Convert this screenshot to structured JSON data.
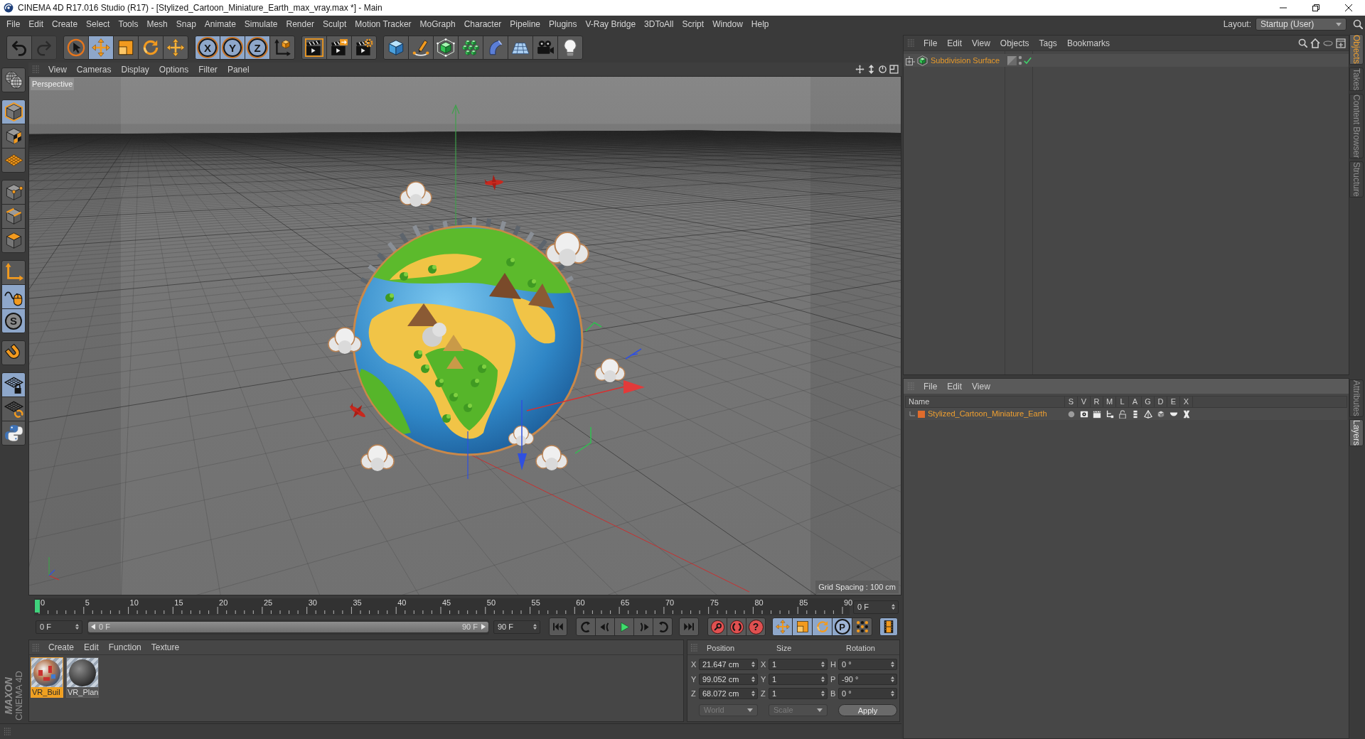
{
  "window": {
    "title": "CINEMA 4D R17.016 Studio (R17) - [Stylized_Cartoon_Miniature_Earth_max_vray.max *] - Main"
  },
  "menu_bar": {
    "items": [
      "File",
      "Edit",
      "Create",
      "Select",
      "Tools",
      "Mesh",
      "Snap",
      "Animate",
      "Simulate",
      "Render",
      "Sculpt",
      "Motion Tracker",
      "MoGraph",
      "Character",
      "Pipeline",
      "Plugins",
      "V-Ray Bridge",
      "3DToAll",
      "Script",
      "Window",
      "Help"
    ],
    "layout_label": "Layout:",
    "layout_value": "Startup (User)"
  },
  "toolbar": {
    "groups": [
      [
        {
          "active": false,
          "disabled": false
        },
        {
          "active": false,
          "disabled": true
        }
      ],
      [
        {
          "active": false,
          "disabled": false
        },
        {
          "active": true,
          "disabled": false
        },
        {
          "active": false,
          "disabled": false
        },
        {
          "active": false,
          "disabled": false
        },
        {
          "active": false,
          "disabled": false
        }
      ],
      [
        {
          "label": "X",
          "active": true,
          "disabled": false
        },
        {
          "label": "Y",
          "active": true,
          "disabled": false
        },
        {
          "label": "Z",
          "active": true,
          "disabled": false
        },
        {
          "active": false,
          "disabled": false
        }
      ],
      [
        {
          "active": false,
          "disabled": false
        },
        {
          "active": false,
          "disabled": false
        },
        {
          "active": false,
          "disabled": false
        }
      ],
      [
        {
          "active": false,
          "disabled": false
        },
        {
          "active": false,
          "disabled": false
        },
        {
          "active": false,
          "disabled": false
        },
        {
          "active": false,
          "disabled": false
        },
        {
          "active": false,
          "disabled": false
        },
        {
          "active": false,
          "disabled": false
        },
        {
          "active": false,
          "disabled": false
        },
        {
          "active": false,
          "disabled": false
        }
      ]
    ]
  },
  "tool_palette": {
    "groups": [
      [
        {
          "active": false
        }
      ],
      [
        {
          "active": true
        },
        {
          "active": false
        },
        {
          "active": false
        }
      ],
      [
        {
          "active": false
        },
        {
          "active": false
        },
        {
          "active": false
        }
      ],
      [
        {
          "active": false
        },
        {
          "active": true
        },
        {
          "label": "S",
          "active": true
        }
      ],
      [
        {
          "active": false
        }
      ],
      [
        {
          "active": true
        },
        {
          "active": false
        },
        {
          "active": false
        }
      ]
    ]
  },
  "viewport": {
    "menu": [
      "View",
      "Cameras",
      "Display",
      "Options",
      "Filter",
      "Panel"
    ],
    "camera": "Perspective",
    "grid_spacing": "Grid Spacing : 100 cm"
  },
  "timeline": {
    "ticks": [
      "0",
      "5",
      "10",
      "15",
      "20",
      "25",
      "30",
      "35",
      "40",
      "45",
      "50",
      "55",
      "60",
      "65",
      "70",
      "75",
      "80",
      "85",
      "90"
    ],
    "playhead": {
      "level": 0
    },
    "current_frame": "0 F",
    "start_frame": "0 F",
    "range_bar": {
      "level": 1
    },
    "range_start": "0 F",
    "range_end": "90 F",
    "end_frame": "90 F",
    "record_label": "?",
    "key_buttons": [
      {
        "active": true
      },
      {
        "active": true
      },
      {
        "active": true
      },
      {
        "label": "P",
        "active": true
      },
      {
        "active": false
      }
    ],
    "film_button": {
      "active": true
    }
  },
  "material_manager": {
    "menu": [
      "Create",
      "Edit",
      "Function",
      "Texture"
    ],
    "materials": [
      {
        "name": "VR_Buil",
        "selected": true
      },
      {
        "name": "VR_Plan",
        "selected": false
      }
    ]
  },
  "logo": {
    "brand": "MAXON",
    "product": "CINEMA 4D"
  },
  "coordinates": {
    "columns": [
      {
        "header": "Position",
        "fields": [
          {
            "axis": "X",
            "value": "21.647 cm"
          },
          {
            "axis": "Y",
            "value": "99.052 cm"
          },
          {
            "axis": "Z",
            "value": "68.072 cm"
          }
        ]
      },
      {
        "header": "Size",
        "fields": [
          {
            "axis": "X",
            "value": "1"
          },
          {
            "axis": "Y",
            "value": "1"
          },
          {
            "axis": "Z",
            "value": "1"
          }
        ]
      },
      {
        "header": "Rotation",
        "fields": [
          {
            "axis": "H",
            "value": "0 °"
          },
          {
            "axis": "P",
            "value": "-90 °"
          },
          {
            "axis": "B",
            "value": "0 °"
          }
        ]
      }
    ],
    "dropdowns": [
      {
        "value": "World",
        "disabled": true
      },
      {
        "value": "Scale",
        "disabled": true
      }
    ],
    "apply": "Apply"
  },
  "object_manager": {
    "menu": [
      "File",
      "Edit",
      "View",
      "Objects",
      "Tags",
      "Bookmarks"
    ],
    "objects": [
      {
        "name": "Subdivision Surface",
        "expanded": false,
        "selected": true,
        "enabled": true
      }
    ]
  },
  "layer_manager": {
    "menu": [
      "File",
      "Edit",
      "View"
    ],
    "columns": [
      "Name",
      "S",
      "V",
      "R",
      "M",
      "L",
      "A",
      "G",
      "D",
      "E",
      "X"
    ],
    "layers": [
      {
        "name": "Stylized_Cartoon_Miniature_Earth",
        "color": "#e06c2c",
        "selected": true
      }
    ]
  },
  "side_tabs": {
    "upper": [
      {
        "label": "Objects",
        "selected": true
      },
      {
        "label": "Takes",
        "selected": false
      },
      {
        "label": "Content Browser",
        "selected": false
      },
      {
        "label": "Structure",
        "selected": false
      }
    ],
    "lower": [
      {
        "label": "Attributes",
        "selected": false
      },
      {
        "label": "Layers",
        "selected": true
      }
    ]
  }
}
